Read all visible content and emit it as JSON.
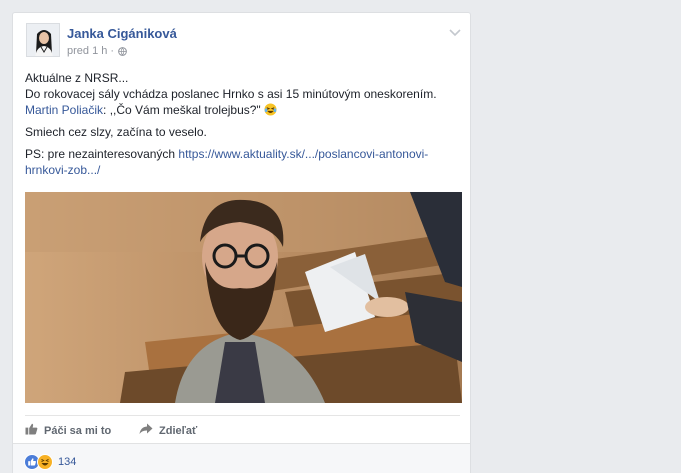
{
  "post": {
    "author": "Janka Cigániková",
    "time": "pred 1 h ·",
    "privacy_icon": "globe-icon",
    "options_icon": "chevron-down-icon",
    "text": {
      "line1": "Aktuálne z NRSR...",
      "line2": "Do rokovacej sály vchádza poslanec Hrnko s asi 15 minútovým oneskorením.",
      "mention": "Martin Poliačik",
      "quote": ": ,,Čo Vám meškal trolejbus?\"",
      "emoji": "laughing-tears-emoji",
      "para2": "Smiech cez slzy, začína to veselo.",
      "ps_prefix": "PS: pre nezainteresovaných ",
      "ps_link": "https://www.aktuality.sk/.../poslancovi-antonovi-hrnkovi-zob.../"
    }
  },
  "actions": {
    "like_label": "Páči sa mi to",
    "like_icon": "thumbs-up-icon",
    "share_label": "Zdieľať",
    "share_icon": "share-arrow-icon"
  },
  "reactions": {
    "icons": [
      "like-reaction-icon",
      "haha-reaction-icon"
    ],
    "count": "134"
  },
  "colors": {
    "link": "#365899",
    "like_blue": "#4c7dd8",
    "haha_yellow": "#f7b125"
  }
}
